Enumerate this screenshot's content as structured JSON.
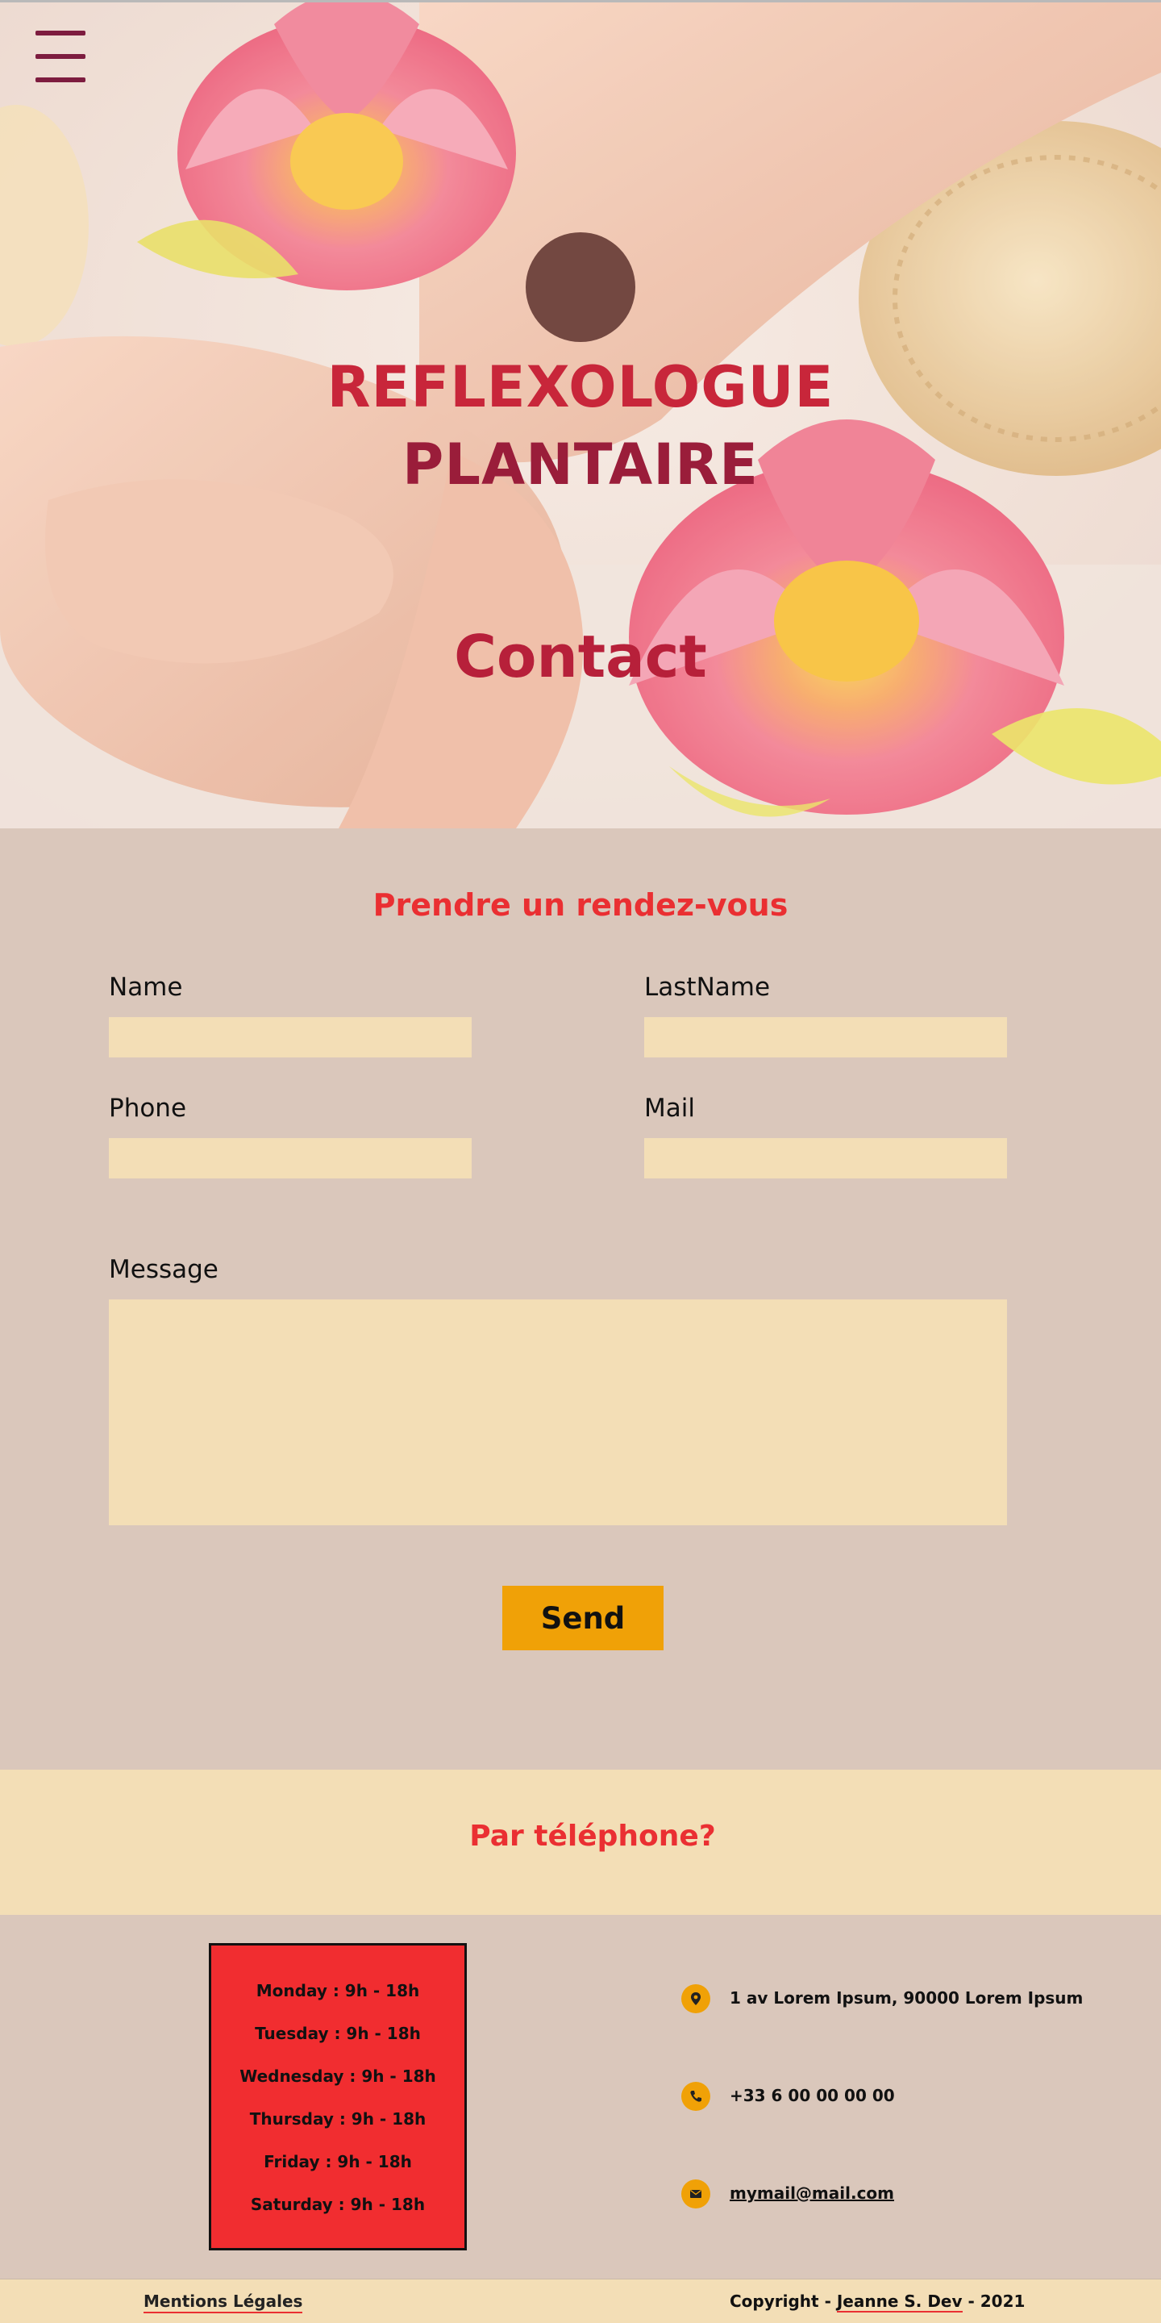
{
  "hero": {
    "brand_line1": "REFLEXOLOGUE",
    "brand_line2": "PLANTAIRE",
    "page_title": "Contact"
  },
  "form": {
    "heading": "Prendre un rendez-vous",
    "name_label": "Name",
    "name_value": "",
    "lastname_label": "LastName",
    "lastname_value": "",
    "phone_label": "Phone",
    "phone_value": "",
    "mail_label": "Mail",
    "mail_value": "",
    "message_label": "Message",
    "message_value": "",
    "send_label": "Send"
  },
  "phone_section": {
    "title": "Par téléphone?"
  },
  "hours": [
    "Monday : 9h - 18h",
    "Tuesday : 9h - 18h",
    "Wednesday : 9h - 18h",
    "Thursday : 9h - 18h",
    "Friday : 9h - 18h",
    "Saturday : 9h - 18h"
  ],
  "contact": {
    "address": "1 av Lorem Ipsum, 90000 Lorem Ipsum",
    "phone": "+33 6 00 00 00 00",
    "email": "mymail@mail.com",
    "icons": [
      "location-pin-icon",
      "phone-icon",
      "envelope-icon"
    ]
  },
  "footer": {
    "legal": "Mentions Légales",
    "copyright_prefix": "Copyright - ",
    "author": "Jeanne S. Dev",
    "copyright_suffix": " - 2021"
  },
  "colors": {
    "accent_red": "#ea2f32",
    "brand_red": "#c8263a",
    "burger": "#7d1c3f",
    "orange": "#f0a107",
    "cream": "#f3deb6",
    "beige": "#dac7bb"
  }
}
